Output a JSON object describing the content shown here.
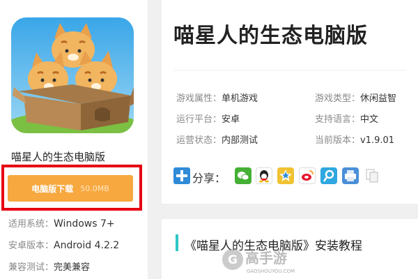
{
  "app": {
    "name": "喵星人的生态电脑版",
    "download_label": "电脑版下载",
    "download_size": "50.0MB"
  },
  "specs": [
    {
      "label": "适用系统：",
      "value": "Windows 7+"
    },
    {
      "label": "安卓版本：",
      "value": "Android 4.2.2"
    },
    {
      "label": "兼容测试：",
      "value": "完美兼容"
    }
  ],
  "detail": {
    "title": "喵星人的生态电脑版",
    "info": [
      {
        "label": "游戏属性：",
        "value": "单机游戏"
      },
      {
        "label": "游戏类型：",
        "value": "休闲益智"
      },
      {
        "label": "运行平台：",
        "value": "安卓"
      },
      {
        "label": "支持语言：",
        "value": "中文"
      },
      {
        "label": "运营状态：",
        "value": "内部测试"
      },
      {
        "label": "当前版本：",
        "value": "v1.9.01"
      }
    ],
    "share_label": "分享："
  },
  "share_icons": [
    "wechat-icon",
    "qq-icon",
    "qzone-icon",
    "weibo-icon",
    "tencent-weibo-icon",
    "print-icon",
    "copy-icon"
  ],
  "tutorial": {
    "title": "《喵星人的生态电脑版》安装教程"
  },
  "watermark": {
    "brand": "高手游",
    "url": "GAOSHOUYOU.COM"
  },
  "colors": {
    "download_button": "#f7a83f",
    "highlight_frame": "#e60012",
    "accent_bar": "#2fc6c6",
    "share_plus": "#2f8bd8"
  }
}
